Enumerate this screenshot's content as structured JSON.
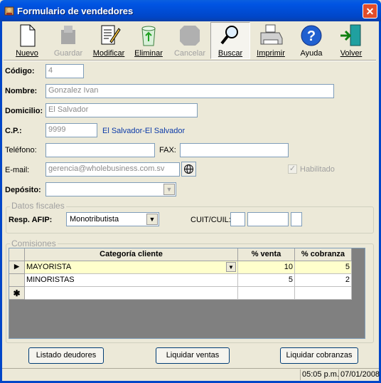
{
  "window": {
    "title": "Formulario de vendedores",
    "close_label": "✕"
  },
  "toolbar": {
    "nuevo": "Nuevo",
    "guardar": "Guardar",
    "modificar": "Modificar",
    "eliminar": "Eliminar",
    "cancelar": "Cancelar",
    "buscar": "Buscar",
    "imprimir": "Imprimir",
    "ayuda": "Ayuda",
    "volver": "Volver"
  },
  "form": {
    "codigo_label": "Código:",
    "codigo_value": "4",
    "nombre_label": "Nombre:",
    "nombre_value": "Gonzalez Ivan",
    "domicilio_label": "Domicilio:",
    "domicilio_value": "El Salvador",
    "cp_label": "C.P.:",
    "cp_value": "9999",
    "cp_location": "El Salvador-El Salvador",
    "telefono_label": "Teléfono:",
    "telefono_value": "",
    "fax_label": "FAX:",
    "fax_value": "",
    "email_label": "E-mail:",
    "email_value": "gerencia@wholebusiness.com.sv",
    "habilitado_label": "Habilitado",
    "habilitado_checked": true,
    "deposito_label": "Depósito:",
    "deposito_value": ""
  },
  "fiscal": {
    "group_title": "Datos fiscales",
    "resp_label": "Resp. AFIP:",
    "resp_value": "Monotributista",
    "cuit_label": "CUIT/CUIL:",
    "cuit_parts": [
      "",
      "",
      ""
    ]
  },
  "comisiones": {
    "group_title": "Comisiones",
    "columns": [
      "Categoría cliente",
      "% venta",
      "% cobranza"
    ],
    "rows": [
      {
        "categoria": "MAYORISTA",
        "venta": "10",
        "cobranza": "5"
      },
      {
        "categoria": "MINORISTAS",
        "venta": "5",
        "cobranza": "2"
      }
    ],
    "new_row_marker": "✱",
    "current_row_marker": "▶"
  },
  "buttons": {
    "listado": "Listado deudores",
    "liquidar_ventas": "Liquidar ventas",
    "liquidar_cobranzas": "Liquidar cobranzas"
  },
  "status": {
    "time": "05:05 p.m.",
    "date": "07/01/2008"
  },
  "colors": {
    "title_bar": "#0054e3",
    "window_bg": "#ece9d8",
    "link_blue": "#0b3aa8",
    "grid_bg": "#808080",
    "selected_row": "#ffffcc"
  }
}
